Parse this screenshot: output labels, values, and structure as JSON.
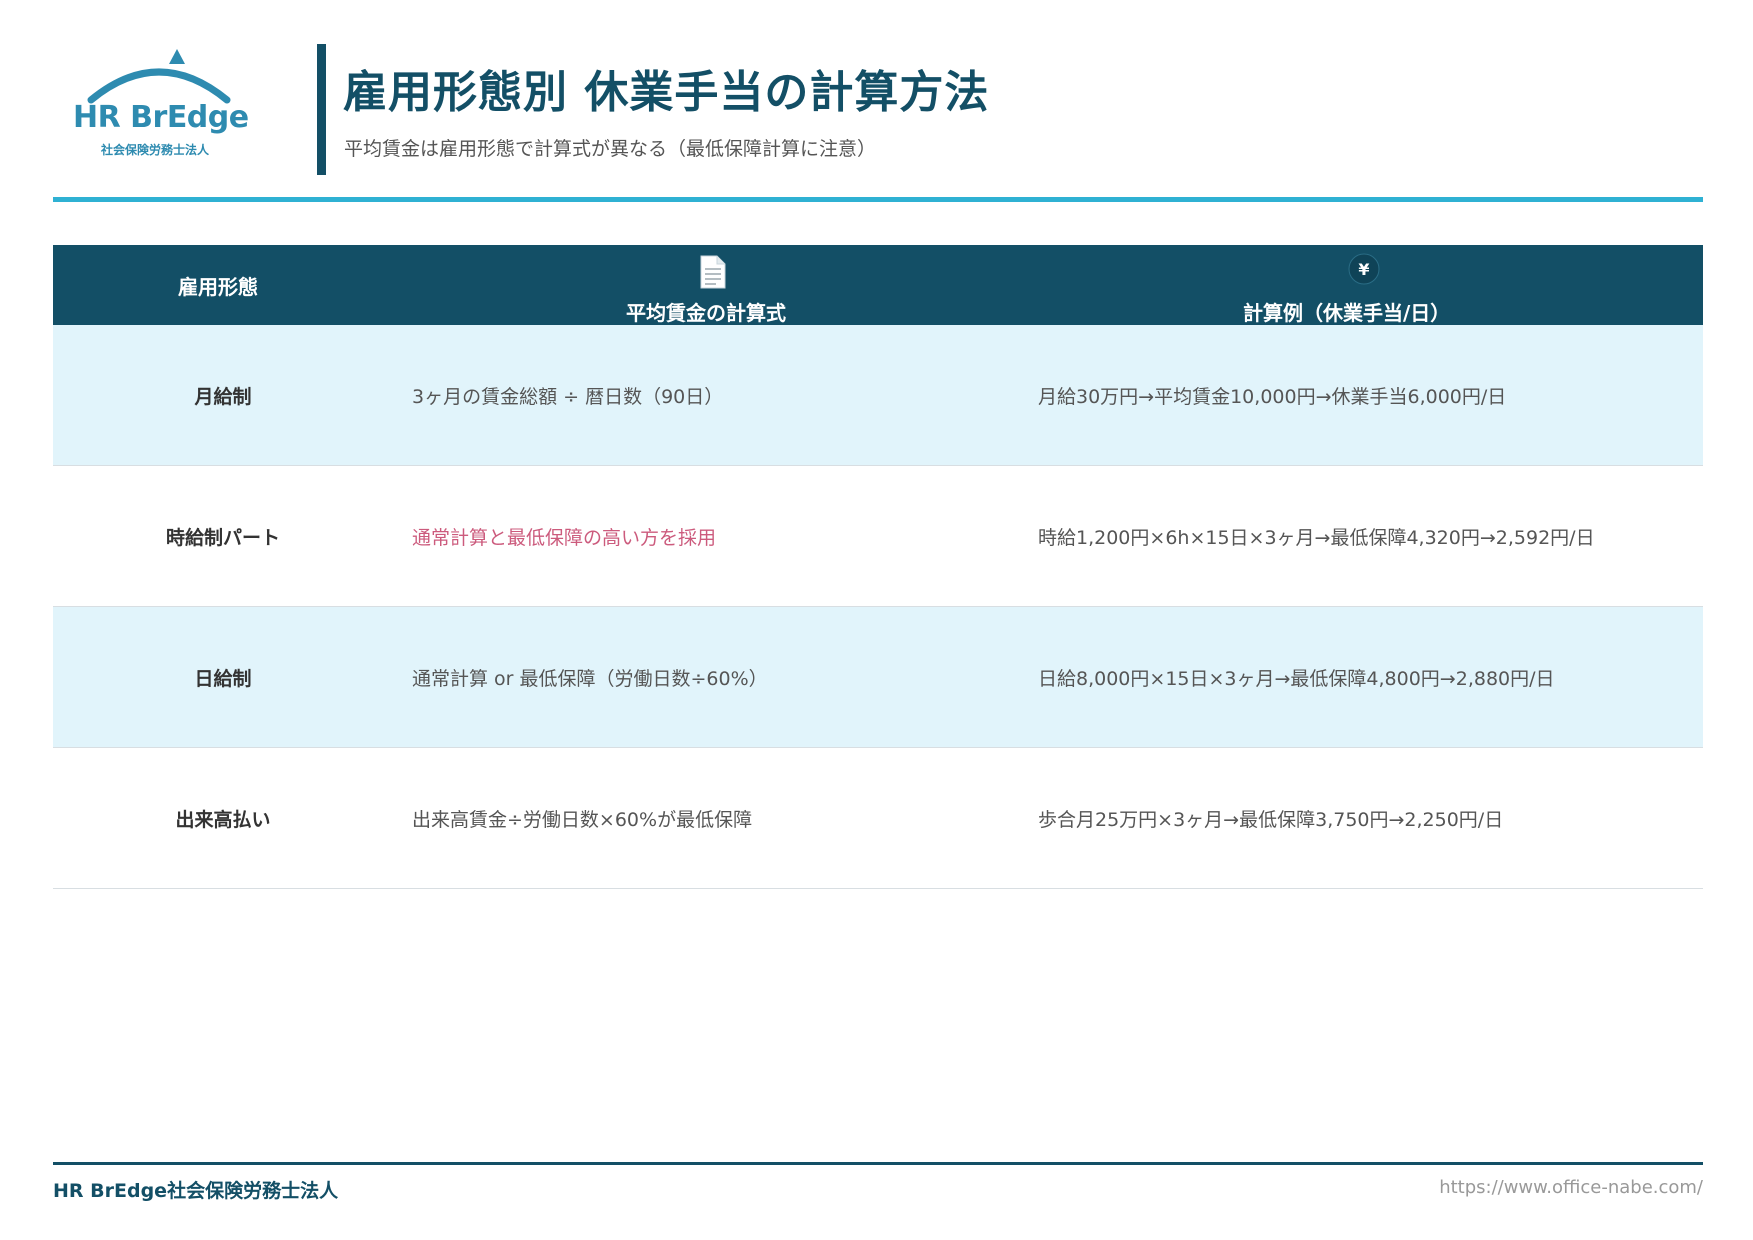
{
  "logo": {
    "name": "HR BrEdge",
    "sub": "社会保険労務士法人",
    "icon": "bridge-arch-logo"
  },
  "header": {
    "title": "雇用形態別 休業手当の計算方法",
    "subtitle": "平均賃金は雇用形態で計算式が異なる（最低保障計算に注意）"
  },
  "table": {
    "headers": {
      "col1": "雇用形態",
      "col2": "平均賃金の計算式",
      "col2_icon": "document-icon",
      "col3": "計算例（休業手当/日）",
      "col3_icon": "yen-icon"
    },
    "rows": [
      {
        "type": "月給制",
        "formula": "3ヶ月の賃金総額 ÷ 暦日数（90日）",
        "example": "月給30万円→平均賃金10,000円→休業手当6,000円/日"
      },
      {
        "type": "時給制パート",
        "formula": "通常計算と最低保障の高い方を採用",
        "example": "時給1,200円×6h×15日×3ヶ月→最低保障4,320円→2,592円/日"
      },
      {
        "type": "日給制",
        "formula": "通常計算 or 最低保障（労働日数÷60%）",
        "example": "日給8,000円×15日×3ヶ月→最低保障4,800円→2,880円/日"
      },
      {
        "type": "出来高払い",
        "formula": "出来高賃金÷労働日数×60%が最低保障",
        "example": "歩合月25万円×3ヶ月→最低保障3,750円→2,250円/日"
      }
    ]
  },
  "footer": {
    "company": "HR BrEdge社会保険労務士法人",
    "url": "https://www.office-nabe.com/"
  },
  "colors": {
    "primary": "#134f66",
    "accent": "#2fb1d3",
    "row_shade": "#e1f4fb",
    "highlight": "#cc5b7d",
    "logo": "#2e8bb0"
  }
}
